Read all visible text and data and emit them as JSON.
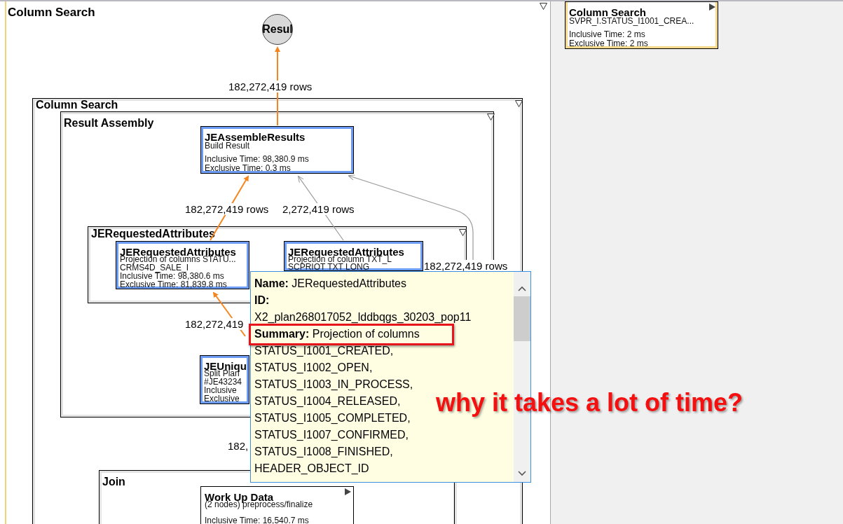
{
  "diagram": {
    "title": "Column Search",
    "collapsible": true,
    "result_node": {
      "label": "Resul"
    },
    "groups": [
      {
        "title": "Column Search",
        "collapsible": true
      },
      {
        "title": "Result Assembly",
        "collapsible": true
      },
      {
        "title": "JERequestedAttributes",
        "collapsible": true
      },
      {
        "title": "Join",
        "collapsible": false
      }
    ],
    "nodes": [
      {
        "kind": "operator",
        "expandable": false,
        "title": "JEAssembleResults",
        "lines": [
          "Build Result",
          "Inclusive Time: 98,380.9 ms",
          "Exclusive Time: 0.3 ms"
        ]
      },
      {
        "kind": "operator",
        "expandable": false,
        "title": "JERequestedAttributes",
        "lines": [
          "Projection of columns STATU...",
          "CRMS4D_SALE_I",
          "Inclusive Time: 98,380.6 ms",
          "Exclusive Time: 81,839.8 ms"
        ]
      },
      {
        "kind": "operator",
        "expandable": false,
        "title": "JERequestedAttributes",
        "lines": [
          "Projection of column TXT_L",
          "SCPRIOT TXT LONG"
        ]
      },
      {
        "kind": "operator",
        "expandable": false,
        "title": "JEUniqu",
        "lines": [
          "Split Plan",
          "#JE43234",
          "Inclusive",
          "Exclusive"
        ]
      },
      {
        "kind": "plain",
        "expandable": true,
        "title": "Work Up Data",
        "lines": [
          "(2 nodes) preprocess/finalize",
          "Inclusive Time: 16,540.7 ms"
        ]
      }
    ],
    "edge_labels": [
      "182,272,419 rows",
      "182,272,419 rows",
      "2,272,419 rows",
      "182,272,419 rows",
      "182,272,419",
      "182,"
    ]
  },
  "side_panel": {
    "node": {
      "kind": "remote",
      "expandable": true,
      "title": "Column Search",
      "lines": [
        "SVPR_I.STATUS_I1001_CREA...",
        "Inclusive Time: 2 ms",
        "Exclusive Time: 2 ms"
      ]
    }
  },
  "tooltip": {
    "lines": [
      {
        "label": "Name:",
        "value": "JERequestedAttributes"
      },
      {
        "label": "ID:"
      },
      {
        "value": "X2_plan268017052_lddbqgs_30203_pop11"
      },
      {
        "label": "Summary:",
        "value": "Projection of columns",
        "highlighted": true
      },
      {
        "value": "STATUS_I1001_CREATED,"
      },
      {
        "value": "STATUS_I1002_OPEN,"
      },
      {
        "value": "STATUS_I1003_IN_PROCESS,"
      },
      {
        "value": "STATUS_I1004_RELEASED,"
      },
      {
        "value": "STATUS_I1005_COMPLETED,"
      },
      {
        "value": "STATUS_I1007_CONFIRMED,"
      },
      {
        "value": "STATUS_I1008_FINISHED,"
      },
      {
        "value": "HEADER_OBJECT_ID"
      }
    ]
  },
  "annotation": {
    "text": "why it takes a lot of time?"
  }
}
